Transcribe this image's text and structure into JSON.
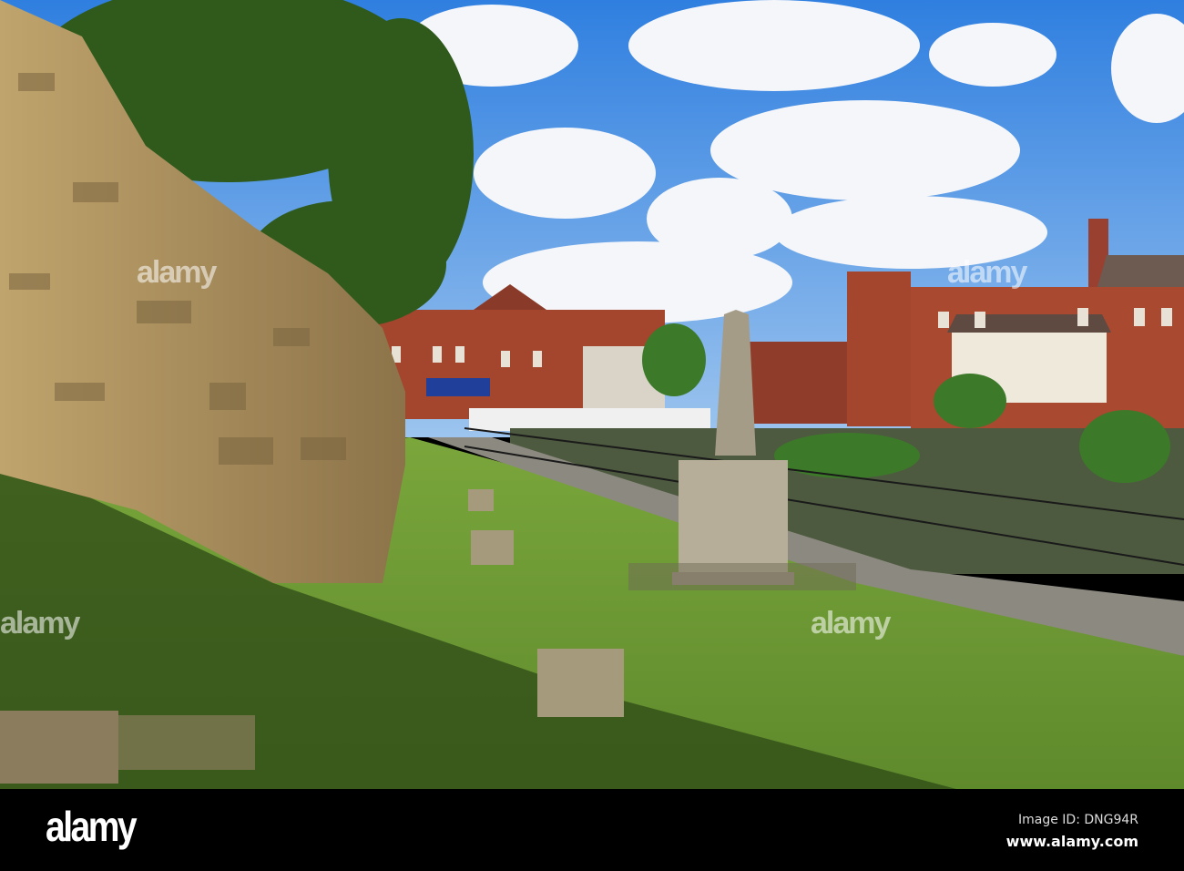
{
  "photo": {
    "subject": "castle-wall-riverside-park",
    "colors": {
      "sky": "#3f8fe6",
      "grass": "#6f9b35",
      "wall": "#a88d5e",
      "brick": "#a4452e",
      "tree": "#2f5a1c"
    }
  },
  "watermark": {
    "text": "alamy"
  },
  "footer": {
    "logo": "alamy",
    "image_id": "Image ID: DNG94R",
    "website": "www.alamy.com"
  }
}
